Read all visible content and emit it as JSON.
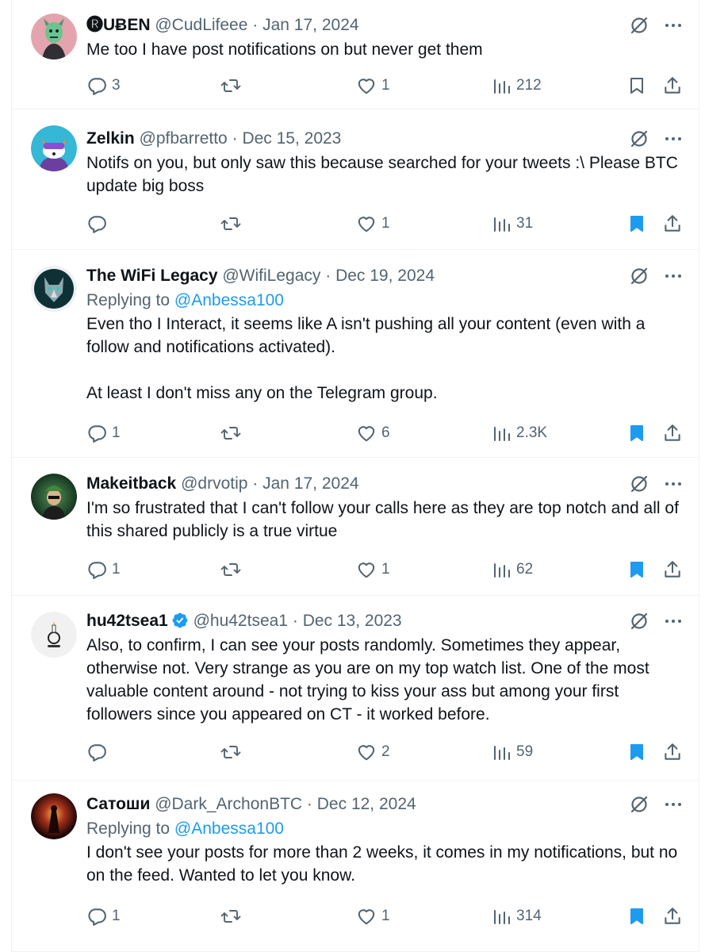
{
  "colors": {
    "accent": "#1d9bf0",
    "secondary_text": "#536471",
    "primary_text": "#0f1419",
    "divider": "#eff3f4",
    "verified": "#1d9bf0"
  },
  "icons": {
    "reply": "speech-bubble-icon",
    "repost": "repost-icon",
    "like": "heart-icon",
    "views": "bar-chart-icon",
    "bookmark": "bookmark-icon",
    "share": "share-icon",
    "grok": "grok-icon",
    "more": "more-dots-icon",
    "verified": "verified-badge-icon"
  },
  "tweets": [
    {
      "name": "🅡UɃEN",
      "handle": "@CudLifeee",
      "separator": "·",
      "date": "Jan 17, 2024",
      "text": "Me too I have post notifications on but never get them",
      "replies": "3",
      "reposts": "",
      "likes": "1",
      "views": "212",
      "bookmarked": false
    },
    {
      "name": "Zelkin",
      "handle": "@pfbarretto",
      "separator": "·",
      "date": "Dec 15, 2023",
      "text": "Notifs on you, but only saw this because searched for your tweets :\\ Please BTC update big boss",
      "replies": "",
      "reposts": "",
      "likes": "1",
      "views": "31",
      "bookmarked": true
    },
    {
      "name": "The WiFi Legacy",
      "handle": "@WifiLegacy",
      "separator": "·",
      "date": "Dec 19, 2024",
      "replying_label": "Replying to",
      "replying_to": "@Anbessa100",
      "text": "Even tho I Interact, it seems like A isn't pushing all your content (even with a follow and notifications activated).\n\nAt least I don't miss any on the Telegram group.",
      "replies": "1",
      "reposts": "",
      "likes": "6",
      "views": "2.3K",
      "bookmarked": true
    },
    {
      "name": "Makeitback",
      "handle": "@drvotip",
      "separator": "·",
      "date": "Jan 17, 2024",
      "text": "I'm so frustrated that I can't follow your calls here as they are top notch and all of this shared publicly is a true virtue",
      "replies": "1",
      "reposts": "",
      "likes": "1",
      "views": "62",
      "bookmarked": true
    },
    {
      "name": "hu42tsea1",
      "verified": true,
      "handle": "@hu42tsea1",
      "separator": "·",
      "date": "Dec 13, 2023",
      "text": "Also, to confirm, I can see your posts randomly. Sometimes they appear, otherwise not. Very strange as you are on my top watch list. One of the most valuable content around - not trying to kiss your ass but among your first followers since you appeared on CT - it worked before.",
      "replies": "",
      "reposts": "",
      "likes": "2",
      "views": "59",
      "bookmarked": true
    },
    {
      "name": "Сатоши",
      "handle": "@Dark_ArchonBTC",
      "separator": "·",
      "date": "Dec 12, 2024",
      "replying_label": "Replying to",
      "replying_to": "@Anbessa100",
      "text": "I don't see your posts for more than 2 weeks, it comes in my notifications, but no on the feed. Wanted to let you know.",
      "replies": "1",
      "reposts": "",
      "likes": "1",
      "views": "314",
      "bookmarked": true
    }
  ]
}
